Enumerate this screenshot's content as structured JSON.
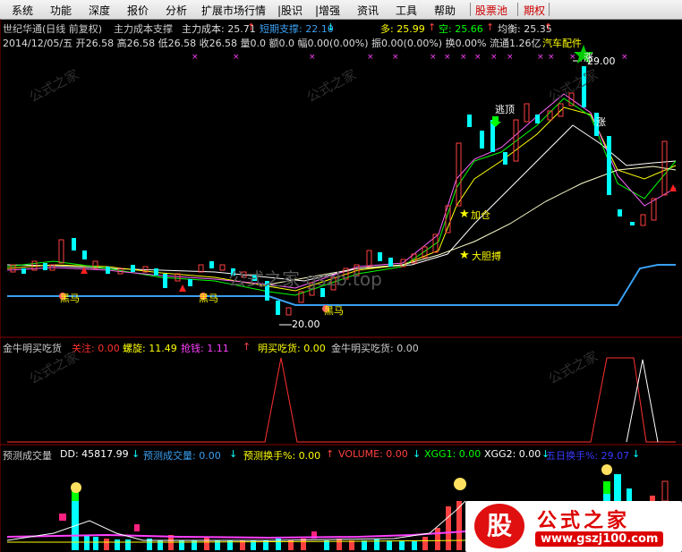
{
  "menu": {
    "items": [
      "系统",
      "功能",
      "深度",
      "报价",
      "分析",
      "扩展市场行情",
      "|股识",
      "|增强",
      "资讯",
      "工具",
      "帮助",
      "股票池",
      "期权"
    ]
  },
  "header": {
    "line1": {
      "title": "世纪华通(日线 前复权)",
      "indicator": "主力成本支撑",
      "cost_label": "主力成本: 25.71",
      "support_label": "短期支撑: 22.10",
      "duo_label": "多: 25.99",
      "kong_label": "空: 25.66",
      "junjia_label": "均衡: 25.35"
    },
    "line2": {
      "info": "2014/12/05/五 开26.58 高26.58 低26.58 收26.58 量0.0 额0.0 幅0.00(0.00%) 振0.00(0.00%) 换0.00% 流通1.26亿",
      "sector": "汽车配件"
    }
  },
  "price_panel": {
    "annotations": {
      "escape": "逃顶",
      "add": "加仓",
      "bold_buy": "大胆搏",
      "fav1": "黑马",
      "fav2": "黑马",
      "fav3": "黑马",
      "low_price": "20.00",
      "high_price": "29.00",
      "top_text": "涨",
      "mid_text": "涨"
    }
  },
  "panel2": {
    "title": "金牛明买吃货",
    "v1": "关注: 0.00",
    "v2": "螺旋: 11.49",
    "v3": "抢钱: 1.11",
    "v4": "明买吃货: 0.00",
    "v5": "金牛明买吃货: 0.00"
  },
  "panel3": {
    "title": "预测成交量",
    "dd": "DD: 45817.99",
    "pred_vol": "预测成交量: 0.00",
    "pred_turn": "预测换手%: 0.00",
    "volume": "VOLUME: 0.00",
    "xgg1": "XGG1: 0.00",
    "xgg2": "XGG2: 0.00",
    "five_day": "五日换手%: 29.07"
  },
  "watermark": {
    "text": "公式之家",
    "url_text": "www.gszj100.com",
    "logo_char": "股",
    "overlay": "公式之家 gszb.top"
  },
  "colors": {
    "up": "#ff4040",
    "down": "#00ffff",
    "support": "#3a9ff0",
    "accent_yellow": "#ffff00"
  }
}
